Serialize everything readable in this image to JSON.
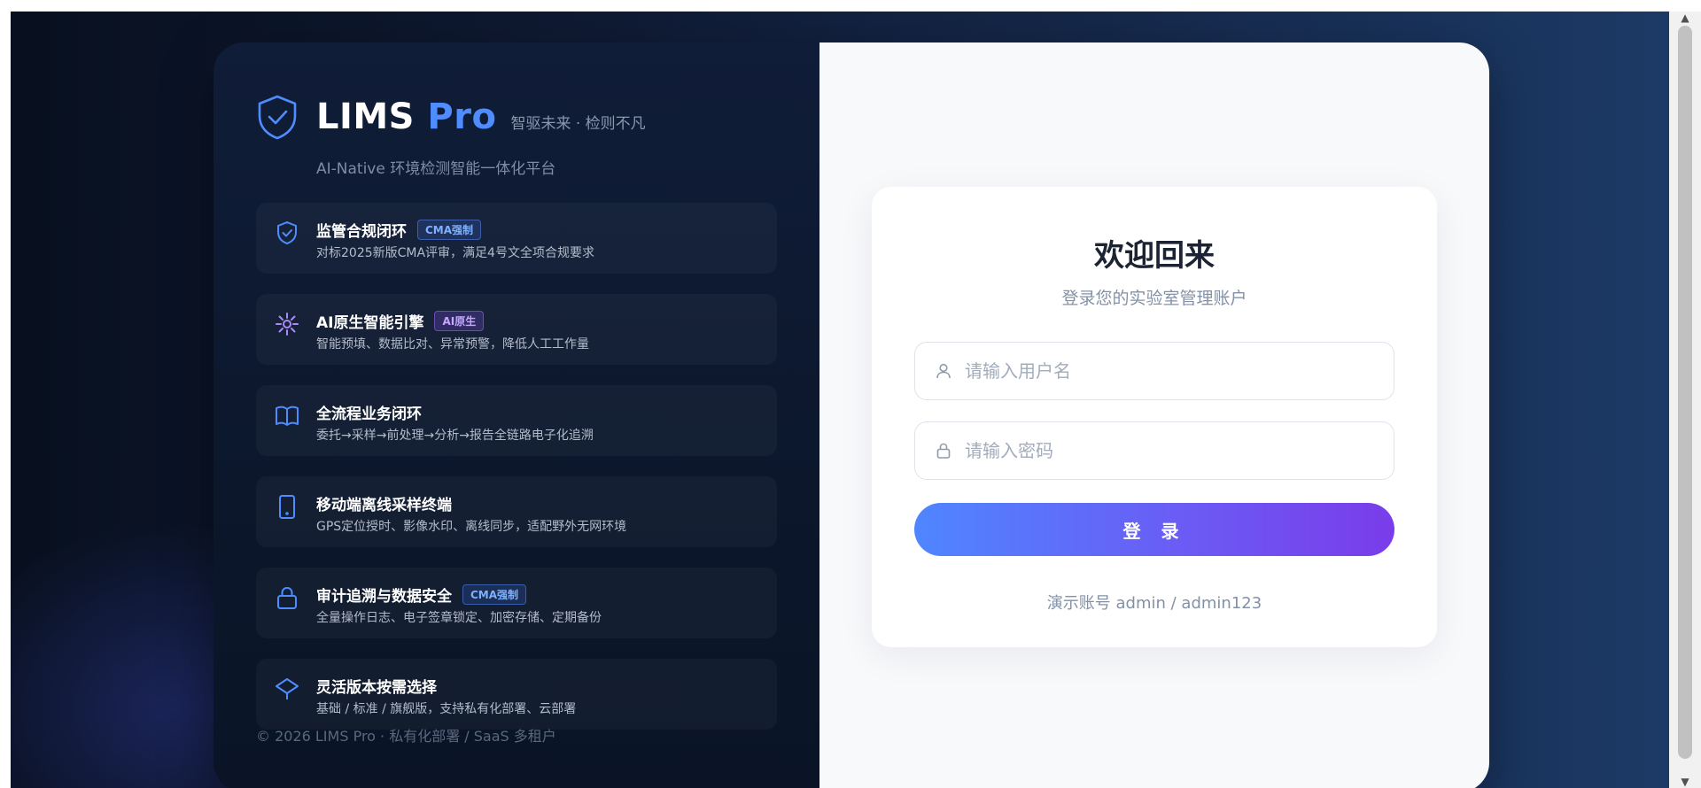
{
  "brand": {
    "name": "LIMS",
    "name_suffix": "Pro",
    "slogan": "智驱未来 · 检则不凡",
    "subtitle": "AI-Native 环境检测智能一体化平台"
  },
  "features": [
    {
      "icon": "shield-check-icon",
      "title": "监管合规闭环",
      "badge": "CMA强制",
      "badge_type": "cma",
      "desc": "对标2025新版CMA评审，满足4号文全项合规要求"
    },
    {
      "icon": "sparkle-icon",
      "title": "AI原生智能引擎",
      "badge": "AI原生",
      "badge_type": "ai",
      "desc": "智能预填、数据比对、异常预警，降低人工工作量"
    },
    {
      "icon": "book-icon",
      "title": "全流程业务闭环",
      "badge": "",
      "badge_type": "",
      "desc": "委托→采样→前处理→分析→报告全链路电子化追溯"
    },
    {
      "icon": "tablet-icon",
      "title": "移动端离线采样终端",
      "badge": "",
      "badge_type": "",
      "desc": "GPS定位授时、影像水印、离线同步，适配野外无网环境"
    },
    {
      "icon": "lock-icon",
      "title": "审计追溯与数据安全",
      "badge": "CMA强制",
      "badge_type": "cma",
      "desc": "全量操作日志、电子签章锁定、加密存储、定期备份"
    },
    {
      "icon": "diamond-icon",
      "title": "灵活版本按需选择",
      "badge": "",
      "badge_type": "",
      "desc": "基础 / 标准 / 旗舰版，支持私有化部署、云部署"
    }
  ],
  "copyright": "© 2026 LIMS Pro · 私有化部署 / SaaS 多租户",
  "login": {
    "title": "欢迎回来",
    "subtitle": "登录您的实验室管理账户",
    "username_placeholder": "请输入用户名",
    "password_placeholder": "请输入密码",
    "submit_label": "登 录",
    "demo_hint": "演示账号 admin / admin123"
  },
  "colors": {
    "accent": "#4f8cff",
    "button_gradient_start": "#4f86ff",
    "button_gradient_end": "#7a3cea"
  }
}
